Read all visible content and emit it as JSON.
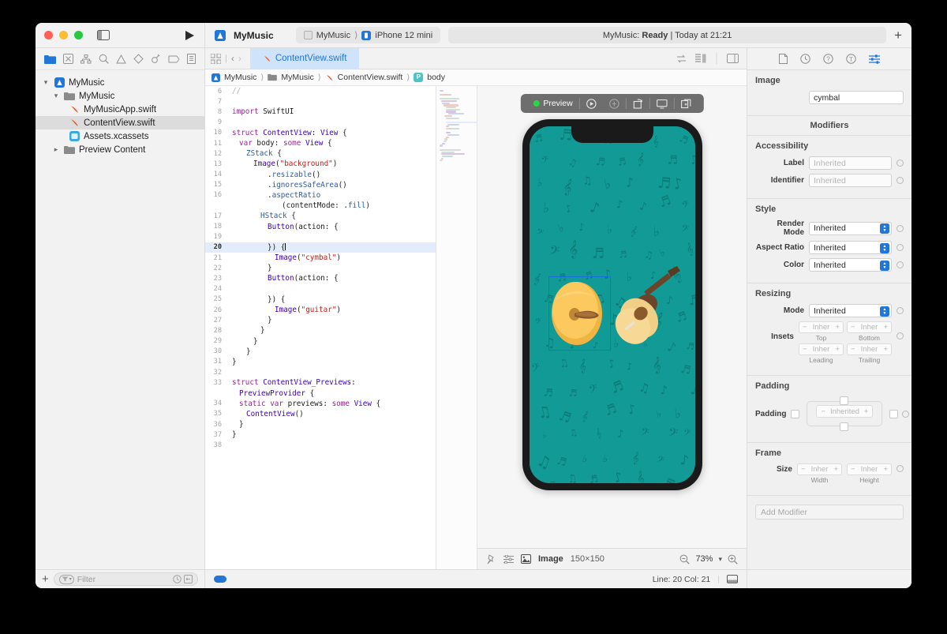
{
  "window": {
    "traffic_lights": [
      "close",
      "minimize",
      "zoom"
    ],
    "project_name": "MyMusic",
    "scheme": "MyMusic",
    "destination": "iPhone 12 mini",
    "status_prefix": "MyMusic:",
    "status_state": "Ready",
    "status_time": "| Today at 21:21",
    "add_button": "+"
  },
  "navigator": {
    "toolbar_icons": [
      "folder-icon",
      "source-control-icon",
      "hierarchy-icon",
      "search-icon",
      "warning-icon",
      "test-icon",
      "debug-icon",
      "breakpoint-icon",
      "report-icon"
    ],
    "tree": [
      {
        "label": "MyMusic",
        "icon": "app-project-icon",
        "depth": 0,
        "disclosure": "open",
        "selected": false
      },
      {
        "label": "MyMusic",
        "icon": "folder-icon",
        "depth": 1,
        "disclosure": "open",
        "selected": false
      },
      {
        "label": "MyMusicApp.swift",
        "icon": "swift-file-icon",
        "depth": 2,
        "disclosure": "",
        "selected": false
      },
      {
        "label": "ContentView.swift",
        "icon": "swift-file-icon",
        "depth": 2,
        "disclosure": "",
        "selected": true
      },
      {
        "label": "Assets.xcassets",
        "icon": "assets-icon",
        "depth": 2,
        "disclosure": "",
        "selected": false
      },
      {
        "label": "Preview Content",
        "icon": "folder-icon",
        "depth": 1,
        "disclosure": "closed",
        "selected": false
      }
    ],
    "filter_placeholder": "Filter"
  },
  "editor": {
    "tab_label": "ContentView.swift",
    "breadcrumb": [
      "MyMusic",
      "MyMusic",
      "ContentView.swift",
      "body"
    ],
    "cursor_line": 20,
    "code_lines": [
      {
        "n": 6,
        "indent": 0,
        "tokens": [
          [
            "cm",
            "//"
          ]
        ]
      },
      {
        "n": 7,
        "indent": 0,
        "tokens": []
      },
      {
        "n": 8,
        "indent": 0,
        "tokens": [
          [
            "k",
            "import"
          ],
          [
            "p",
            " SwiftUI"
          ]
        ]
      },
      {
        "n": 9,
        "indent": 0,
        "tokens": []
      },
      {
        "n": 10,
        "indent": 0,
        "tokens": [
          [
            "k",
            "struct"
          ],
          [
            "p",
            " "
          ],
          [
            "t",
            "ContentView"
          ],
          [
            "p",
            ": "
          ],
          [
            "t",
            "View"
          ],
          [
            "p",
            " {"
          ]
        ]
      },
      {
        "n": 11,
        "indent": 1,
        "tokens": [
          [
            "k",
            "var"
          ],
          [
            "p",
            " body: "
          ],
          [
            "k",
            "some"
          ],
          [
            "p",
            " "
          ],
          [
            "t",
            "View"
          ],
          [
            "p",
            " {"
          ]
        ]
      },
      {
        "n": 12,
        "indent": 2,
        "tokens": [
          [
            "f",
            "ZStack"
          ],
          [
            "p",
            " {"
          ]
        ]
      },
      {
        "n": 13,
        "indent": 3,
        "tokens": [
          [
            "t",
            "Image"
          ],
          [
            "p",
            "("
          ],
          [
            "s",
            "\"background\""
          ],
          [
            "p",
            ")"
          ]
        ]
      },
      {
        "n": 14,
        "indent": 5,
        "tokens": [
          [
            "p",
            "."
          ],
          [
            "f",
            "resizable"
          ],
          [
            "p",
            "()"
          ]
        ]
      },
      {
        "n": 15,
        "indent": 5,
        "tokens": [
          [
            "p",
            "."
          ],
          [
            "f",
            "ignoresSafeArea"
          ],
          [
            "p",
            "()"
          ]
        ]
      },
      {
        "n": 16,
        "indent": 5,
        "tokens": [
          [
            "p",
            "."
          ],
          [
            "f",
            "aspectRatio"
          ]
        ]
      },
      {
        "n": "",
        "indent": 7,
        "tokens": [
          [
            "p",
            "(contentMode: ."
          ],
          [
            "f",
            "fill"
          ],
          [
            "p",
            ")"
          ]
        ]
      },
      {
        "n": 17,
        "indent": 4,
        "tokens": [
          [
            "f",
            "HStack"
          ],
          [
            "p",
            " {"
          ]
        ]
      },
      {
        "n": 18,
        "indent": 5,
        "tokens": [
          [
            "t",
            "Button"
          ],
          [
            "p",
            "(action: {"
          ]
        ]
      },
      {
        "n": 19,
        "indent": 0,
        "tokens": []
      },
      {
        "n": 20,
        "indent": 5,
        "tokens": [
          [
            "p",
            "}) {"
          ]
        ],
        "highlight": true,
        "caret": true
      },
      {
        "n": 21,
        "indent": 6,
        "tokens": [
          [
            "t",
            "Image"
          ],
          [
            "p",
            "("
          ],
          [
            "s",
            "\"cymbal\""
          ],
          [
            "p",
            ")"
          ]
        ]
      },
      {
        "n": 22,
        "indent": 5,
        "tokens": [
          [
            "p",
            "}"
          ]
        ]
      },
      {
        "n": 23,
        "indent": 5,
        "tokens": [
          [
            "t",
            "Button"
          ],
          [
            "p",
            "(action: {"
          ]
        ]
      },
      {
        "n": 24,
        "indent": 0,
        "tokens": []
      },
      {
        "n": 25,
        "indent": 5,
        "tokens": [
          [
            "p",
            "}) {"
          ]
        ]
      },
      {
        "n": 26,
        "indent": 6,
        "tokens": [
          [
            "t",
            "Image"
          ],
          [
            "p",
            "("
          ],
          [
            "s",
            "\"guitar\""
          ],
          [
            "p",
            ")"
          ]
        ]
      },
      {
        "n": 27,
        "indent": 5,
        "tokens": [
          [
            "p",
            "}"
          ]
        ]
      },
      {
        "n": 28,
        "indent": 4,
        "tokens": [
          [
            "p",
            "}"
          ]
        ]
      },
      {
        "n": 29,
        "indent": 3,
        "tokens": [
          [
            "p",
            "}"
          ]
        ]
      },
      {
        "n": 30,
        "indent": 2,
        "tokens": [
          [
            "p",
            "}"
          ]
        ]
      },
      {
        "n": 31,
        "indent": 0,
        "tokens": [
          [
            "p",
            "}"
          ]
        ]
      },
      {
        "n": 32,
        "indent": 0,
        "tokens": []
      },
      {
        "n": 33,
        "indent": 0,
        "tokens": [
          [
            "k",
            "struct"
          ],
          [
            "p",
            " "
          ],
          [
            "t",
            "ContentView_Previews"
          ],
          [
            "p",
            ":"
          ]
        ]
      },
      {
        "n": "",
        "indent": 1,
        "tokens": [
          [
            "t",
            "PreviewProvider"
          ],
          [
            "p",
            " {"
          ]
        ]
      },
      {
        "n": 34,
        "indent": 1,
        "tokens": [
          [
            "k",
            "static"
          ],
          [
            "p",
            " "
          ],
          [
            "k",
            "var"
          ],
          [
            "p",
            " previews: "
          ],
          [
            "k",
            "some"
          ],
          [
            "p",
            " "
          ],
          [
            "t",
            "View"
          ],
          [
            "p",
            " {"
          ]
        ]
      },
      {
        "n": 35,
        "indent": 2,
        "tokens": [
          [
            "t",
            "ContentView"
          ],
          [
            "p",
            "()"
          ]
        ]
      },
      {
        "n": 36,
        "indent": 1,
        "tokens": [
          [
            "p",
            "}"
          ]
        ]
      },
      {
        "n": 37,
        "indent": 0,
        "tokens": [
          [
            "p",
            "}"
          ]
        ]
      },
      {
        "n": 38,
        "indent": 0,
        "tokens": []
      }
    ]
  },
  "preview": {
    "toolbar_label": "Preview",
    "toolbar_icons": [
      "live-preview-icon",
      "inspect-preview-icon",
      "refresh-preview-icon",
      "device-preview-icon",
      "duplicate-preview-icon"
    ],
    "device": "iPhone 12 mini",
    "screen_bg_color": "#119a96",
    "selection_color": "#1a6ee0",
    "bottom_bar": {
      "pin_icon": "pin-icon",
      "variants_icon": "variants-icon",
      "image_icon": "image-icon",
      "label": "Image",
      "dimensions": "150×150",
      "zoom_out_icon": "zoom-out-icon",
      "zoom_value": "73%",
      "zoom_in_icon": "zoom-in-icon"
    }
  },
  "inspector": {
    "toolbar_icons": [
      "file-inspector-icon",
      "history-inspector-icon",
      "help-inspector-icon",
      "accessibility-inspector-icon",
      "attributes-inspector-icon"
    ],
    "image_section": {
      "title": "Image",
      "value": "cymbal"
    },
    "modifiers_header": "Modifiers",
    "accessibility": {
      "title": "Accessibility",
      "fields": [
        {
          "label": "Label",
          "placeholder": "Inherited"
        },
        {
          "label": "Identifier",
          "placeholder": "Inherited"
        }
      ]
    },
    "style": {
      "title": "Style",
      "fields": [
        {
          "label": "Render Mode",
          "value": "Inherited"
        },
        {
          "label": "Aspect Ratio",
          "value": "Inherited"
        },
        {
          "label": "Color",
          "value": "Inherited"
        }
      ]
    },
    "resizing": {
      "title": "Resizing",
      "mode_label": "Mode",
      "mode_value": "Inherited",
      "insets_label": "Insets",
      "insets": [
        {
          "caption": "Top",
          "value": "Inher"
        },
        {
          "caption": "Bottom",
          "value": "Inher"
        },
        {
          "caption": "Leading",
          "value": "Inher"
        },
        {
          "caption": "Trailing",
          "value": "Inher"
        }
      ]
    },
    "padding": {
      "title": "Padding",
      "label": "Padding",
      "value": "Inherited"
    },
    "frame": {
      "title": "Frame",
      "size_label": "Size",
      "fields": [
        {
          "caption": "Width",
          "value": "Inher"
        },
        {
          "caption": "Height",
          "value": "Inher"
        }
      ]
    },
    "add_modifier_placeholder": "Add Modifier"
  },
  "statusbar": {
    "line_col": "Line: 20  Col: 21"
  }
}
